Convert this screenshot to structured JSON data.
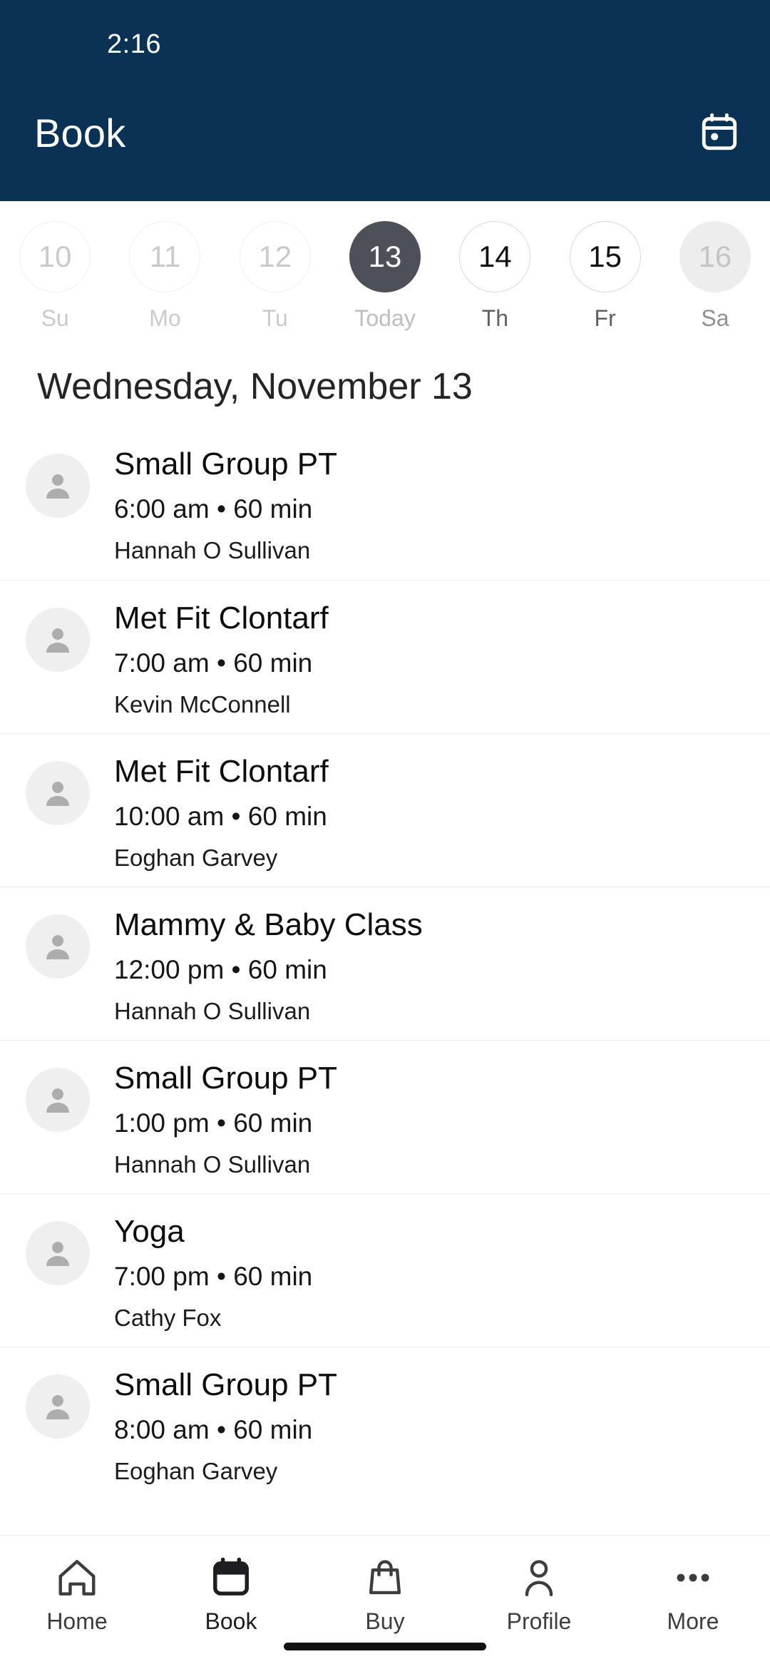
{
  "status_bar": {
    "time": "2:16"
  },
  "app_bar": {
    "title": "Book",
    "calendar_icon": "calendar-icon"
  },
  "theme": {
    "header_background": "#0a3254",
    "selected_day_background": "#4e5059",
    "page_background": "#ffffff",
    "divider": "#ececec",
    "avatar_background": "#efefef"
  },
  "date_strip": {
    "days": [
      {
        "number": "10",
        "label": "Su",
        "state": "past"
      },
      {
        "number": "11",
        "label": "Mo",
        "state": "past"
      },
      {
        "number": "12",
        "label": "Tu",
        "state": "past"
      },
      {
        "number": "13",
        "label": "Today",
        "state": "today"
      },
      {
        "number": "14",
        "label": "Th",
        "state": "future"
      },
      {
        "number": "15",
        "label": "Fr",
        "state": "future"
      },
      {
        "number": "16",
        "label": "Sa",
        "state": "muted"
      }
    ]
  },
  "day_heading": "Wednesday, November 13",
  "classes": [
    {
      "title": "Small Group PT",
      "time": "6:00 am • 60 min",
      "host": "Hannah O Sullivan"
    },
    {
      "title": "Met Fit Clontarf",
      "time": "7:00 am • 60 min",
      "host": "Kevin McConnell"
    },
    {
      "title": "Met Fit Clontarf",
      "time": "10:00 am • 60 min",
      "host": "Eoghan Garvey"
    },
    {
      "title": "Mammy & Baby Class",
      "time": "12:00 pm • 60 min",
      "host": "Hannah O Sullivan"
    },
    {
      "title": "Small Group PT",
      "time": "1:00 pm • 60 min",
      "host": "Hannah O Sullivan"
    },
    {
      "title": "Yoga",
      "time": "7:00 pm • 60 min",
      "host": "Cathy Fox"
    },
    {
      "title": "Small Group PT",
      "time": "8:00 am • 60 min",
      "host": "Eoghan Garvey"
    }
  ],
  "bottom_nav": {
    "items": [
      {
        "label": "Home",
        "icon": "home-icon",
        "active": false
      },
      {
        "label": "Book",
        "icon": "calendar-icon",
        "active": true
      },
      {
        "label": "Buy",
        "icon": "bag-icon",
        "active": false
      },
      {
        "label": "Profile",
        "icon": "person-icon",
        "active": false
      },
      {
        "label": "More",
        "icon": "ellipsis-icon",
        "active": false
      }
    ]
  }
}
